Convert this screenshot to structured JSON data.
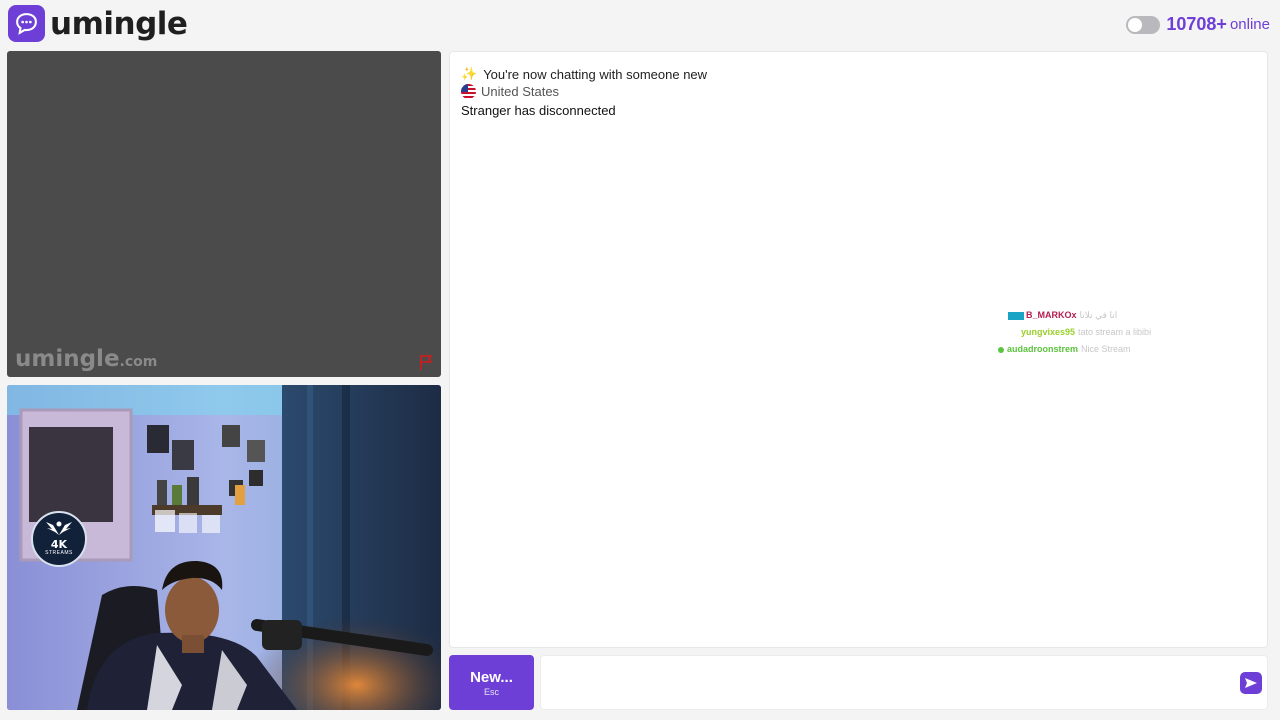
{
  "header": {
    "brand": "umingle",
    "online_count": "10708+",
    "online_label": "online",
    "toggle_state": "off"
  },
  "stranger_video": {
    "watermark_main": "umingle",
    "watermark_suffix": ".com",
    "report_icon": "flag-icon"
  },
  "self_video": {
    "avatar_text": "4K",
    "avatar_subtext": "STREAMS"
  },
  "chat": {
    "messages": [
      {
        "icon": "sparkles-emoji",
        "text": "You're now chatting with someone new"
      },
      {
        "icon": "us-flag-icon",
        "text": "United States"
      },
      {
        "icon": "",
        "text": "Stranger has disconnected"
      }
    ],
    "stream_overlay": [
      {
        "user": "B_MARKOx",
        "text": "انا في تلاتا"
      },
      {
        "user": "yungvixes95",
        "text": "tato stream a libibi"
      },
      {
        "user": "audadroonstrem",
        "text": "Nice Stream"
      }
    ]
  },
  "controls": {
    "new_label": "New...",
    "new_hint": "Esc",
    "input_value": "",
    "input_placeholder": "",
    "send_icon": "send-icon"
  },
  "colors": {
    "accent": "#6d3fd6",
    "video_bg": "#4b4b4b",
    "report": "#c81e1e"
  }
}
